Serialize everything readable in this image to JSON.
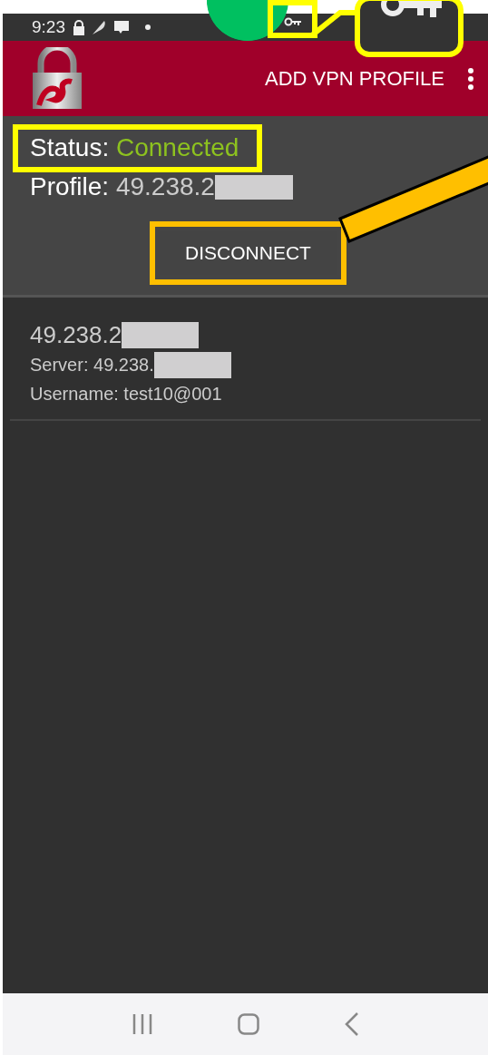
{
  "status_bar": {
    "time": "9:23"
  },
  "app_bar": {
    "action": "ADD VPN PROFILE"
  },
  "status_panel": {
    "status_label": "Status:",
    "status_value": "Connected",
    "profile_label": "Profile:",
    "profile_value": "49.238.2",
    "button": "DISCONNECT"
  },
  "profiles": [
    {
      "name": "49.238.2",
      "server": "Server: 49.238.",
      "username": "Username: test10@001"
    }
  ]
}
